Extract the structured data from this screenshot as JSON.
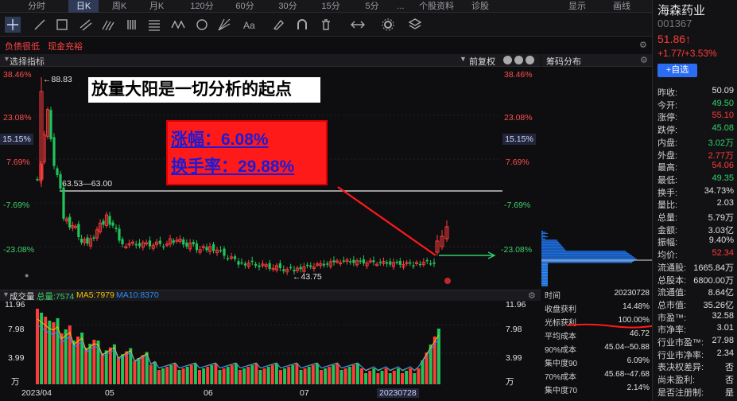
{
  "tabs": [
    "分时",
    "日K",
    "周K",
    "月K",
    "120分",
    "60分",
    "30分",
    "15分",
    "5分",
    "...",
    "个股资料",
    "诊股"
  ],
  "tabs_active": "日K",
  "top_right": {
    "display": "显示",
    "draw": "画线"
  },
  "alerts": {
    "debt": "负债很低",
    "cash": "现金充裕"
  },
  "chart_header": {
    "indicator": "选择指标",
    "adjust": "前复权"
  },
  "chip_header": {
    "title": "筹码分布"
  },
  "axis_left": [
    "38.46%",
    "23.08%",
    "15.15%",
    "7.69%",
    "-7.69%",
    "-23.08%"
  ],
  "axis_right": [
    "38.46%",
    "23.08%",
    "15.15%",
    "7.69%",
    "-7.69%",
    "-23.08%"
  ],
  "annotations": {
    "high": "←88.83",
    "low": "←43.75",
    "level": "63.53—63.00",
    "banner": "放量大阳是一切分析的起点",
    "gain": "涨幅：6.08%",
    "turnover": "换手率：29.88%"
  },
  "volume": {
    "title": "成交量",
    "total": "总量:7574",
    "ma5": "MA5:7979",
    "ma10": "MA10:8370",
    "axis": [
      "11.96",
      "7.98",
      "3.99",
      "万"
    ],
    "axis_right": [
      "11.96",
      "7.98",
      "3.99",
      "万"
    ]
  },
  "x_axis": [
    "2023/04",
    "05",
    "06",
    "07",
    "20230728"
  ],
  "stock": {
    "name": "海森药业",
    "code": "001367",
    "price": "51.86↑",
    "change": "+1.77/+3.53%",
    "watch_button": "+自选"
  },
  "quote": [
    {
      "k": "昨收:",
      "v": "50.09",
      "c": "white"
    },
    {
      "k": "今开:",
      "v": "49.50",
      "c": "green"
    },
    {
      "k": "涨停:",
      "v": "55.10",
      "c": "red"
    },
    {
      "k": "跌停:",
      "v": "45.08",
      "c": "green"
    },
    {
      "k": "内盘:",
      "v": "3.02万",
      "c": "green"
    },
    {
      "k": "外盘:",
      "v": "2.77万",
      "c": "red"
    },
    {
      "k": "最高:",
      "v": "54.06",
      "c": "red"
    },
    {
      "k": "最低:",
      "v": "49.35",
      "c": "green"
    },
    {
      "k": "换手:",
      "v": "34.73%",
      "c": "white"
    },
    {
      "k": "量比:",
      "v": "2.03",
      "c": "white"
    },
    {
      "k": "总量:",
      "v": "5.79万",
      "c": "white"
    },
    {
      "k": "金额:",
      "v": "3.03亿",
      "c": "white"
    },
    {
      "k": "振幅:",
      "v": "9.40%",
      "c": "white"
    },
    {
      "k": "均价:",
      "v": "52.34",
      "c": "red"
    },
    {
      "k": "流通股:",
      "v": "1665.84万",
      "c": "white"
    },
    {
      "k": "总股本:",
      "v": "6800.00万",
      "c": "white"
    },
    {
      "k": "流通值:",
      "v": "8.64亿",
      "c": "white"
    },
    {
      "k": "总市值:",
      "v": "35.26亿",
      "c": "white"
    },
    {
      "k": "市盈™:",
      "v": "32.58",
      "c": "white"
    },
    {
      "k": "市净率:",
      "v": "3.01",
      "c": "white"
    },
    {
      "k": "行业市盈™:",
      "v": "27.98",
      "c": "white"
    },
    {
      "k": "行业市净率:",
      "v": "2.34",
      "c": "white"
    },
    {
      "k": "表决权差异:",
      "v": "否",
      "c": "white"
    },
    {
      "k": "尚未盈利:",
      "v": "否",
      "c": "white"
    },
    {
      "k": "是否注册制:",
      "v": "是",
      "c": "white"
    }
  ],
  "chip_stats": [
    {
      "k": "时间",
      "v": "20230728"
    },
    {
      "k": "收盘获利",
      "v": "14.48%"
    },
    {
      "k": "光标获利",
      "v": "100.00%"
    },
    {
      "k": "平均成本",
      "v": "46.72"
    },
    {
      "k": "90%成本",
      "v": "45.04--50.88"
    },
    {
      "k": "集中度90",
      "v": "6.09%"
    },
    {
      "k": "70%成本",
      "v": "45.68--47.68"
    },
    {
      "k": "集中度70",
      "v": "2.14%"
    }
  ],
  "colors": {
    "up": "#ff3b3b",
    "down": "#1fc45a",
    "ma5": "#f2c200",
    "ma10": "#2e8cff",
    "accent": "#2a6df4"
  }
}
